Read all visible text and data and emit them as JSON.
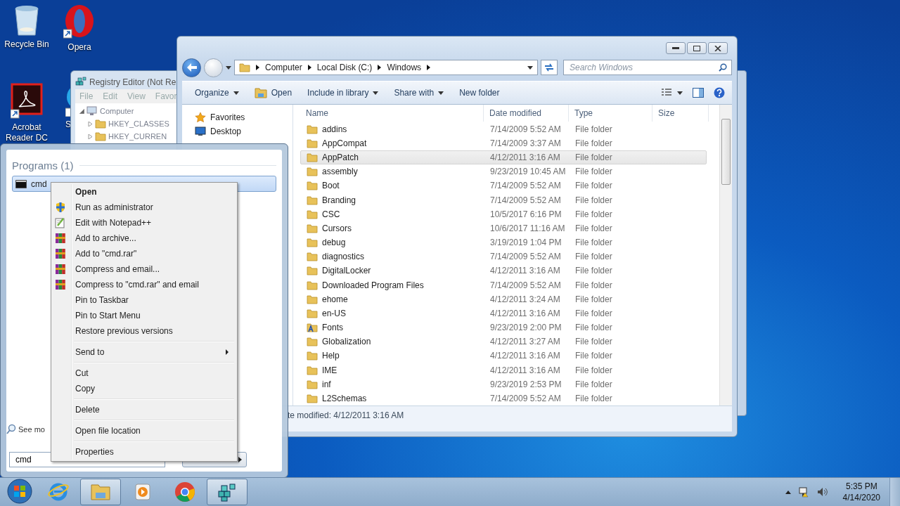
{
  "desktop_icons": [
    {
      "label": "Recycle Bin",
      "kind": "recycle"
    },
    {
      "label": "Opera",
      "kind": "opera"
    },
    {
      "label": "Acrobat Reader DC",
      "kind": "acrobat"
    },
    {
      "label": "S",
      "kind": "generic"
    }
  ],
  "registry_editor": {
    "title": "Registry Editor (Not Re",
    "menu": [
      "File",
      "Edit",
      "View",
      "Favor"
    ],
    "tree": [
      {
        "label": "Computer",
        "kind": "computer",
        "children": [
          {
            "label": "HKEY_CLASSES",
            "kind": "folder"
          },
          {
            "label": "HKEY_CURREN",
            "kind": "folder"
          }
        ]
      }
    ]
  },
  "explorer": {
    "breadcrumb": [
      "Computer",
      "Local Disk (C:)",
      "Windows"
    ],
    "search": {
      "placeholder": "Search Windows"
    },
    "toolbar": [
      {
        "label": "Organize",
        "kind": "menu"
      },
      {
        "label": "Open",
        "kind": "open"
      },
      {
        "label": "Include in library",
        "kind": "menu"
      },
      {
        "label": "Share with",
        "kind": "menu"
      },
      {
        "label": "New folder",
        "kind": "plain"
      }
    ],
    "nav": [
      {
        "label": "Favorites",
        "kind": "star"
      },
      {
        "label": "Desktop",
        "kind": "desktop"
      }
    ],
    "columns": [
      "Name",
      "Date modified",
      "Type",
      "Size"
    ],
    "rows": [
      {
        "name": "addins",
        "date": "7/14/2009 5:52 AM",
        "type": "File folder",
        "kind": "folder",
        "selected": false
      },
      {
        "name": "AppCompat",
        "date": "7/14/2009 3:37 AM",
        "type": "File folder",
        "kind": "folder",
        "selected": false
      },
      {
        "name": "AppPatch",
        "date": "4/12/2011 3:16 AM",
        "type": "File folder",
        "kind": "folder",
        "selected": true
      },
      {
        "name": "assembly",
        "date": "9/23/2019 10:45 AM",
        "type": "File folder",
        "kind": "folder",
        "selected": false
      },
      {
        "name": "Boot",
        "date": "7/14/2009 5:52 AM",
        "type": "File folder",
        "kind": "folder",
        "selected": false
      },
      {
        "name": "Branding",
        "date": "7/14/2009 5:52 AM",
        "type": "File folder",
        "kind": "folder",
        "selected": false
      },
      {
        "name": "CSC",
        "date": "10/5/2017 6:16 PM",
        "type": "File folder",
        "kind": "folder",
        "selected": false
      },
      {
        "name": "Cursors",
        "date": "10/6/2017 11:16 AM",
        "type": "File folder",
        "kind": "folder",
        "selected": false
      },
      {
        "name": "debug",
        "date": "3/19/2019 1:04 PM",
        "type": "File folder",
        "kind": "folder",
        "selected": false
      },
      {
        "name": "diagnostics",
        "date": "7/14/2009 5:52 AM",
        "type": "File folder",
        "kind": "folder",
        "selected": false
      },
      {
        "name": "DigitalLocker",
        "date": "4/12/2011 3:16 AM",
        "type": "File folder",
        "kind": "folder",
        "selected": false
      },
      {
        "name": "Downloaded Program Files",
        "date": "7/14/2009 5:52 AM",
        "type": "File folder",
        "kind": "folder",
        "selected": false
      },
      {
        "name": "ehome",
        "date": "4/12/2011 3:24 AM",
        "type": "File folder",
        "kind": "folder",
        "selected": false
      },
      {
        "name": "en-US",
        "date": "4/12/2011 3:16 AM",
        "type": "File folder",
        "kind": "folder",
        "selected": false
      },
      {
        "name": "Fonts",
        "date": "9/23/2019 2:00 PM",
        "type": "File folder",
        "kind": "fonts",
        "selected": false
      },
      {
        "name": "Globalization",
        "date": "4/12/2011 3:27 AM",
        "type": "File folder",
        "kind": "folder",
        "selected": false
      },
      {
        "name": "Help",
        "date": "4/12/2011 3:16 AM",
        "type": "File folder",
        "kind": "folder",
        "selected": false
      },
      {
        "name": "IME",
        "date": "4/12/2011 3:16 AM",
        "type": "File folder",
        "kind": "folder",
        "selected": false
      },
      {
        "name": "inf",
        "date": "9/23/2019 2:53 PM",
        "type": "File folder",
        "kind": "folder",
        "selected": false
      },
      {
        "name": "L2Schemas",
        "date": "7/14/2009 5:52 AM",
        "type": "File folder",
        "kind": "folder",
        "selected": false
      }
    ],
    "status": "te modified:  4/12/2011 3:16 AM"
  },
  "start_menu": {
    "heading": "Programs (1)",
    "results": [
      {
        "label": "cmd",
        "selected": true
      }
    ],
    "see_more": "See mo",
    "search": {
      "value": "cmd"
    }
  },
  "context_menu": {
    "groups": [
      [
        {
          "label": "Open",
          "default": true
        },
        {
          "label": "Run as administrator",
          "kind": "shield"
        },
        {
          "label": "Edit with Notepad++",
          "kind": "notepad"
        },
        {
          "label": "Add to archive...",
          "kind": "archive"
        },
        {
          "label": "Add to \"cmd.rar\"",
          "kind": "archive"
        },
        {
          "label": "Compress and email...",
          "kind": "archive"
        },
        {
          "label": "Compress to \"cmd.rar\" and email",
          "kind": "archive"
        },
        {
          "label": "Pin to Taskbar"
        },
        {
          "label": "Pin to Start Menu"
        },
        {
          "label": "Restore previous versions"
        }
      ],
      [
        {
          "label": "Send to",
          "submenu": true
        }
      ],
      [
        {
          "label": "Cut"
        },
        {
          "label": "Copy"
        }
      ],
      [
        {
          "label": "Delete"
        }
      ],
      [
        {
          "label": "Open file location"
        }
      ],
      [
        {
          "label": "Properties"
        }
      ]
    ]
  },
  "taskbar": {
    "items": [
      {
        "kind": "ie",
        "active": false
      },
      {
        "kind": "explorer",
        "active": true
      },
      {
        "kind": "media",
        "active": false
      },
      {
        "kind": "chrome",
        "active": false
      },
      {
        "kind": "regedit",
        "active": true
      }
    ],
    "time": "5:35 PM",
    "date": "4/14/2020"
  }
}
